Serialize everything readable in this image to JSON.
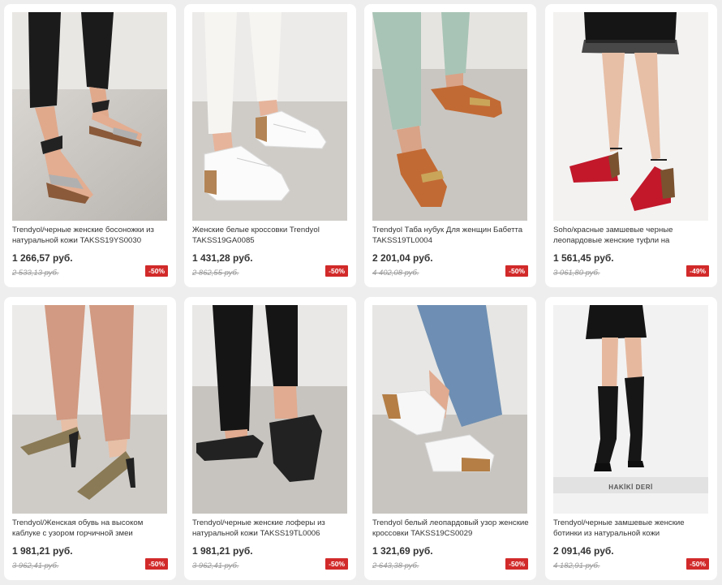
{
  "products": [
    {
      "title": "Trendyol/черные женские босоножки из натуральной кожи TAKSS19YS0030",
      "price": "1 266,57 руб.",
      "old_price": "2 533,13 руб.",
      "discount": "-50%",
      "image": "black-sandals-photo"
    },
    {
      "title": "Женские белые кроссовки Trendyol TAKSS19GA0085",
      "price": "1 431,28 руб.",
      "old_price": "2 862,55 руб.",
      "discount": "-50%",
      "image": "white-sneakers-photo"
    },
    {
      "title": "Trendyol Таба нубук Для женщин Бабетта TAKSS19TL0004",
      "price": "2 201,04 руб.",
      "old_price": "4 402,08 руб.",
      "discount": "-50%",
      "image": "tan-loafers-photo"
    },
    {
      "title": "Soho/красные замшевые черные леопардовые женские туфли на",
      "price": "1 561,45 руб.",
      "old_price": "3 061,80 руб.",
      "discount": "-49%",
      "image": "red-heels-photo"
    },
    {
      "title": "Trendyol/Женская обувь на высоком каблуке с узором горчичной змеи",
      "price": "1 981,21 руб.",
      "old_price": "3 962,41 руб.",
      "discount": "-50%",
      "image": "snake-heels-photo"
    },
    {
      "title": "Trendyol/черные женские лоферы из натуральной кожи TAKSS19TL0006",
      "price": "1 981,21 руб.",
      "old_price": "3 962,41 руб.",
      "discount": "-50%",
      "image": "black-loafers-photo"
    },
    {
      "title": "Trendyol белый леопардовый узор женские кроссовки TAKSS19CS0029",
      "price": "1 321,69 руб.",
      "old_price": "2 643,38 руб.",
      "discount": "-50%",
      "image": "leopard-sneakers-photo"
    },
    {
      "title": "Trendyol/черные замшевые женские ботинки из натуральной кожи",
      "price": "2 091,46 руб.",
      "old_price": "4 182,91 руб.",
      "discount": "-50%",
      "image": "black-boots-photo",
      "overlay": "HAKİKİ DERİ"
    }
  ],
  "colors": {
    "badge": "#d22a2a",
    "background": "#eeeeee",
    "card": "#ffffff"
  }
}
